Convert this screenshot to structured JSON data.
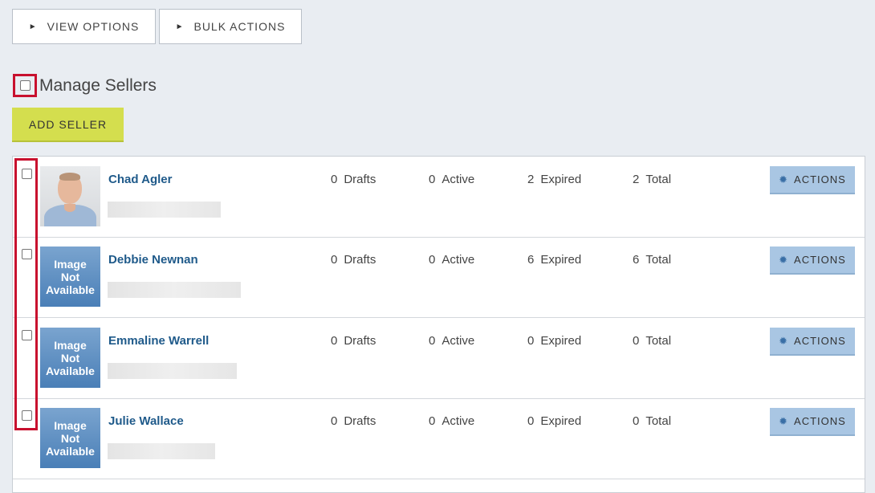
{
  "toolbar": {
    "view_options": "VIEW OPTIONS",
    "bulk_actions": "BULK ACTIONS",
    "arrow": "►"
  },
  "heading": {
    "title": "Manage Sellers"
  },
  "add_seller": "ADD SELLER",
  "sellers": [
    {
      "name": "Chad Agler",
      "drafts": "0",
      "active": "0",
      "expired": "2",
      "total": "2",
      "image": "photo"
    },
    {
      "name": "Debbie Newnan",
      "drafts": "0",
      "active": "0",
      "expired": "6",
      "total": "6",
      "image": "Image Not Available"
    },
    {
      "name": "Emmaline Warrell",
      "drafts": "0",
      "active": "0",
      "expired": "0",
      "total": "0",
      "image": "Image Not Available"
    },
    {
      "name": "Julie Wallace",
      "drafts": "0",
      "active": "0",
      "expired": "0",
      "total": "0",
      "image": "Image Not Available"
    }
  ],
  "labels": {
    "drafts": "Drafts",
    "active": "Active",
    "expired": "Expired",
    "total": "Total",
    "actions": "ACTIONS",
    "no_image_1": "Image",
    "no_image_2": "Not",
    "no_image_3": "Available"
  },
  "icons": {
    "toolbar_arrow": "triangle-right-icon",
    "actions": "gear-icon"
  },
  "colors": {
    "highlight": "#c8102e",
    "add_button": "#d4de4e",
    "actions_button": "#a9c6e3",
    "link": "#1f5a8a"
  }
}
